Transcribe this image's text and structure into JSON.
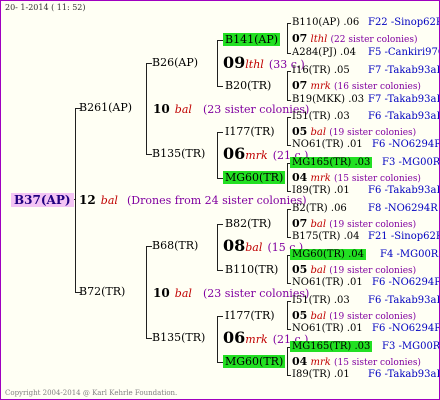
{
  "header": "20- 1-2014 ( 11: 52)",
  "footer": "Copyright 2004-2014 @ Karl Kehrle Foundation.",
  "root": {
    "id": "B37(AP)",
    "gen": "12",
    "breed": "bal",
    "note": "(Drones from 24 sister colonies)"
  },
  "gen1": [
    {
      "id": "B261(AP)",
      "gen": "10",
      "breed": "bal",
      "note": "(23 sister colonies)"
    },
    {
      "id": "B72(TR)",
      "gen": "10",
      "breed": "bal",
      "note": "(23 sister colonies)"
    }
  ],
  "gen2": [
    {
      "id": "B26(AP)",
      "gen": "09",
      "breed": "lthl",
      "note": "(33 c.)"
    },
    {
      "id": "B135(TR)",
      "gen": "06",
      "breed": "mrk",
      "note": "(21 c.)"
    },
    {
      "id": "B68(TR)",
      "gen": "08",
      "breed": "bal",
      "note": "(15 c.)"
    },
    {
      "id": "B135(TR)",
      "gen": "06",
      "breed": "mrk",
      "note": "(21 c.)"
    }
  ],
  "gen3": [
    "B141(AP)",
    "B20(TR)",
    "I177(TR)",
    "MG60(TR)",
    "B82(TR)",
    "B110(TR)",
    "I177(TR)",
    "MG60(TR)"
  ],
  "gen4": [
    {
      "id": "B110(AP) .06",
      "ref": "F22 -Sinop62R"
    },
    {
      "gen": "07",
      "breed": "lthl",
      "note": "(22 sister colonies)"
    },
    {
      "id": "A284(PJ) .04",
      "ref": "F5 -Cankiri97Q"
    },
    {
      "id": "I16(TR) .05",
      "ref": "F7 -Takab93aR"
    },
    {
      "gen": "07",
      "breed": "mrk",
      "note": "(16 sister colonies)"
    },
    {
      "id": "B19(MKK) .03",
      "ref": "F7 -Takab93aR"
    },
    {
      "id": "I51(TR) .03",
      "ref": "F6 -Takab93aR"
    },
    {
      "gen": "05",
      "breed": "bal",
      "note": "(19 sister colonies)"
    },
    {
      "id": "NO61(TR) .01",
      "ref": "F6 -NO6294R"
    },
    {
      "id": "MG165(TR) .03",
      "ref": "F3 -MG00R"
    },
    {
      "gen": "04",
      "breed": "mrk",
      "note": "(15 sister colonies)"
    },
    {
      "id": "I89(TR) .01",
      "ref": "F6 -Takab93aR"
    },
    {
      "id": "B2(TR) .06",
      "ref": "F8 -NO6294R"
    },
    {
      "gen": "07",
      "breed": "bal",
      "note": "(19 sister colonies)"
    },
    {
      "id": "B175(TR) .04",
      "ref": "F21 -Sinop62R"
    },
    {
      "id": "MG60(TR) .04",
      "ref": "F4 -MG00R"
    },
    {
      "gen": "05",
      "breed": "bal",
      "note": "(19 sister colonies)"
    },
    {
      "id": "NO61(TR) .01",
      "ref": "F6 -NO6294R"
    },
    {
      "id": "I51(TR) .03",
      "ref": "F6 -Takab93aR"
    },
    {
      "gen": "05",
      "breed": "bal",
      "note": "(19 sister colonies)"
    },
    {
      "id": "NO61(TR) .01",
      "ref": "F6 -NO6294R"
    },
    {
      "id": "MG165(TR) .03",
      "ref": "F3 -MG00R"
    },
    {
      "gen": "04",
      "breed": "mrk",
      "note": "(15 sister colonies)"
    },
    {
      "id": "I89(TR) .01",
      "ref": "F6 -Takab93aR"
    }
  ]
}
